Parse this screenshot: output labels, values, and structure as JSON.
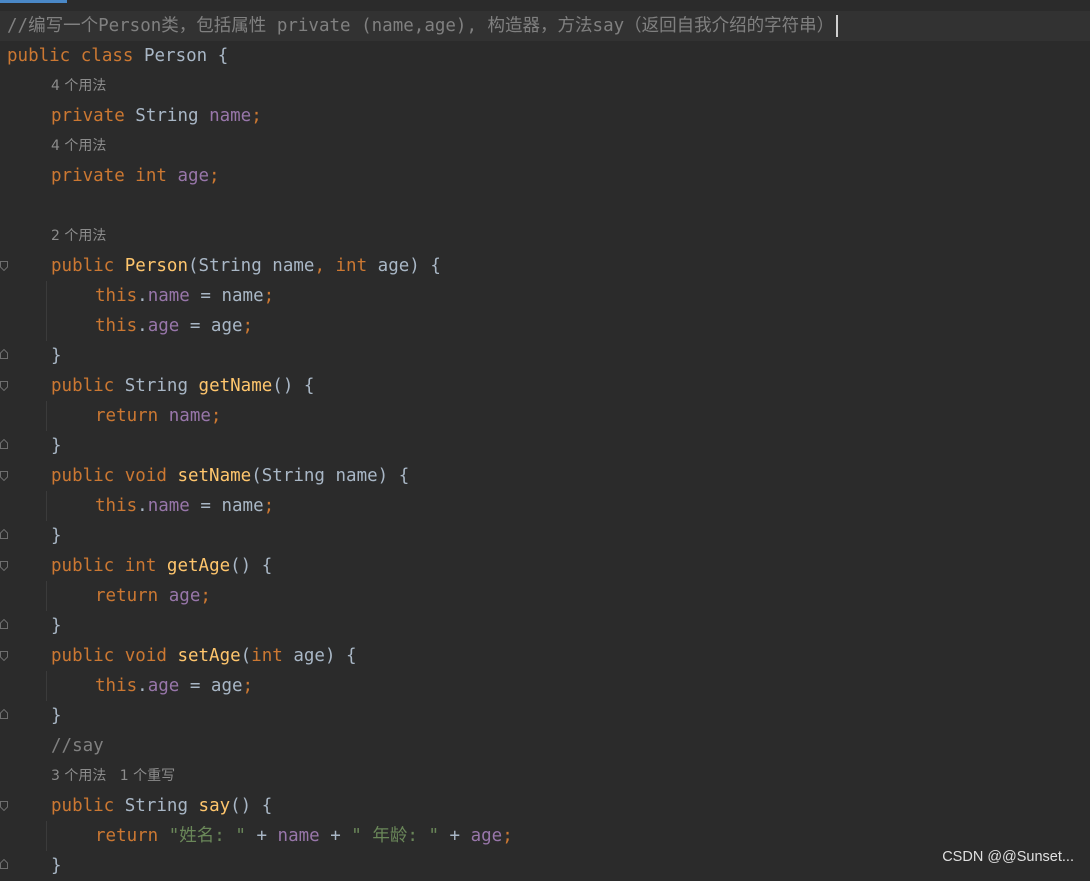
{
  "comment_line": "//编写一个Person类，包括属性 private (name,age), 构造器，方法say（返回自我介绍的字符串）",
  "hints": {
    "name_usages": "4 个用法",
    "age_usages": "4 个用法",
    "ctor_usages": "2 个用法",
    "say_usages": "3 个用法",
    "say_overrides": "1 个重写"
  },
  "code": {
    "class_name": "Person",
    "field_name": "name",
    "field_age": "age",
    "type_string": "String",
    "type_int": "int",
    "method_getName": "getName",
    "method_setName": "setName",
    "method_getAge": "getAge",
    "method_setAge": "setAge",
    "method_say": "say",
    "say_comment": "//say",
    "str_name_label": "\"姓名: \"",
    "str_age_label": "\" 年龄: \""
  },
  "watermark": "CSDN @@Sunset...",
  "colors": {
    "background": "#2b2b2b",
    "keyword": "#cc7832",
    "field": "#9876aa",
    "function": "#ffc66d",
    "comment": "#808080",
    "string": "#6a8759",
    "text": "#a9b7c6"
  }
}
